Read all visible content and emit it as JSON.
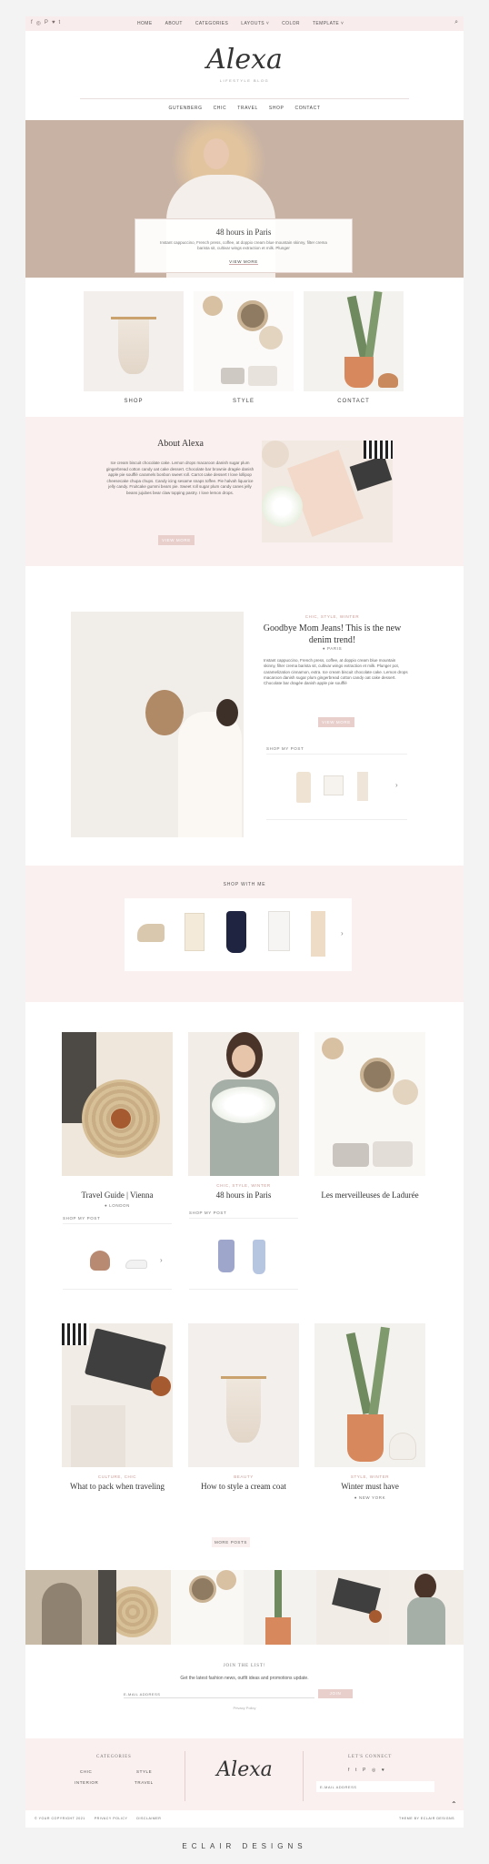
{
  "topbar": {
    "social_icons": [
      "f",
      "◎",
      "P",
      "♥",
      "t"
    ],
    "nav": [
      "HOME",
      "ABOUT",
      "CATEGORIES",
      "LAYOUTS ˅",
      "COLOR",
      "TEMPLATE ˅"
    ],
    "search_icon": "⌕"
  },
  "logo": {
    "text": "Alexa",
    "tagline": "LIFESTYLE BLOG"
  },
  "subnav": [
    "GUTENBERG",
    "CHIC",
    "TRAVEL",
    "SHOP",
    "CONTACT"
  ],
  "hero": {
    "title": "48 hours in Paris",
    "excerpt": "Instant cappuccino, French press, coffee, at doppio cream blue mountain skinny, filter crema barista sit, cultivar wings extraction et milk. Plunger",
    "button": "VIEW MORE"
  },
  "categories": [
    "SHOP",
    "STYLE",
    "CONTACT"
  ],
  "about": {
    "title": "About Alexa",
    "text": "Ice cream biscuit chocolate cake. Lemon drops macaroon danish sugar plum gingerbread cotton candy oat cake dessert. Chocolate bar brownie dragée danish apple pie soufflé caramels bonbon sweet roll. Carrot cake dessert I love lollipop cheesecake chupa chups. Candy icing sesame snaps toffee. Pie halvah liquorice jelly candy. Fruitcake gummi bears pie. Sweet roll sugar plum candy canes jelly beans jujubes bear claw topping pastry. I love lemon drops.",
    "button": "VIEW MORE"
  },
  "featured": {
    "category": "CHIC, STYLE, WINTER",
    "title": "Goodbye Mom Jeans! This is the new denim trend!",
    "location": "● PARIS",
    "text": "Instant cappuccino, French press, coffee, at doppio cream blue mountain skinny, filter crema barista sit, cultivar wings extraction et milk. Plunger pot, caramelization cinnamon, extra. Ice cream biscuit chocolate cake. Lemon drops macaroon danish sugar plum gingerbread cotton candy oat cake dessert. Chocolate bar dragée danish apple pie soufflé",
    "button": "VIEW MORE",
    "shop_label": "SHOP MY POST",
    "arrow": "›"
  },
  "shop_with_me": {
    "title": "SHOP WITH ME",
    "arrow": "›"
  },
  "posts_row1": [
    {
      "category": "",
      "title": "Travel Guide | Vienna",
      "location": "● LONDON",
      "shop_label": "SHOP MY POST"
    },
    {
      "category": "CHIC, STYLE, WINTER",
      "title": "48 hours in Paris",
      "location": "",
      "shop_label": "SHOP MY POST"
    },
    {
      "category": "",
      "title": "Les merveilleuses de Ladurée",
      "location": "",
      "shop_label": ""
    }
  ],
  "posts_row2": [
    {
      "category": "CULTURE, CHIC",
      "title": "What to pack when traveling",
      "location": ""
    },
    {
      "category": "BEAUTY",
      "title": "How to style a cream coat",
      "location": ""
    },
    {
      "category": "STYLE, WINTER",
      "title": "Winter must have",
      "location": "● NEW YORK"
    }
  ],
  "more_posts": "MORE POSTS",
  "newsletter": {
    "title": "JOIN THE LIST!",
    "subtitle": "Get the latest fashion news, outfit ideas and promotions update.",
    "placeholder": "E-MAIL ADDRESS",
    "button": "JOIN",
    "privacy": "Privacy Policy"
  },
  "footer": {
    "categories_title": "CATEGORIES",
    "categories": [
      "CHIC",
      "STYLE",
      "INTERIOR",
      "TRAVEL"
    ],
    "logo": "Alexa",
    "connect_title": "LET'S CONNECT",
    "social_icons": [
      "f",
      "t",
      "P",
      "◎",
      "♥"
    ],
    "email_placeholder": "E-MAIL ADDRESS"
  },
  "bottom": {
    "copyright": "© YOUR COPYRIGHT 2021",
    "privacy": "PRIVACY POLICY",
    "disclaimer": "DISCLAIMER",
    "theme_by": "THEME BY ECLAIR DESIGNS",
    "to_top": "⌃"
  },
  "brand": "ECLAIR DESIGNS",
  "colors": {
    "accent_pink": "#e8cfcb",
    "band_pink": "#faf0ef",
    "hero_bg": "#c8b2a3"
  }
}
